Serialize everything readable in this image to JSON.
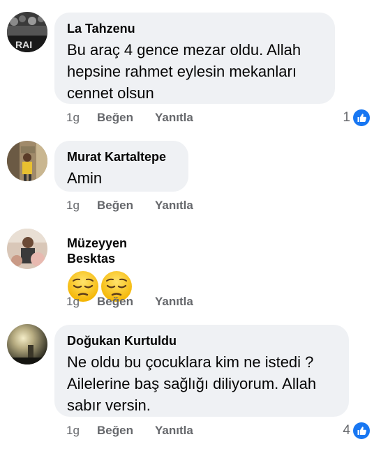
{
  "actions": {
    "like_label": "Beğen",
    "reply_label": "Yanıtla"
  },
  "colors": {
    "bubble": "#eff1f4",
    "meta": "#65676b",
    "like_blue": "#1877f2"
  },
  "comments": [
    {
      "author": "La Tahzenu",
      "lines": [
        "Bu araç 4 gence mezar oldu. Allah",
        "hepsine rahmet eylesin mekanları",
        "cennet olsun"
      ],
      "time": "1g",
      "reaction_count": "1",
      "reaction_icon": "like-icon"
    },
    {
      "author": "Murat Kartaltepe",
      "lines": [
        "Amin"
      ],
      "time": "1g"
    },
    {
      "author": "Müzeyyen Besktas",
      "emoji": [
        "pensive-face-icon",
        "pensive-face-icon"
      ],
      "time": "1g"
    },
    {
      "author": "Doğukan Kurtuldu",
      "lines": [
        "Ne oldu bu çocuklara kim ne istedi ?",
        "Ailelerine baş sağlığı diliyorum. Allah",
        "sabır versin."
      ],
      "time": "1g",
      "reaction_count": "4",
      "reaction_icon": "like-icon"
    }
  ]
}
